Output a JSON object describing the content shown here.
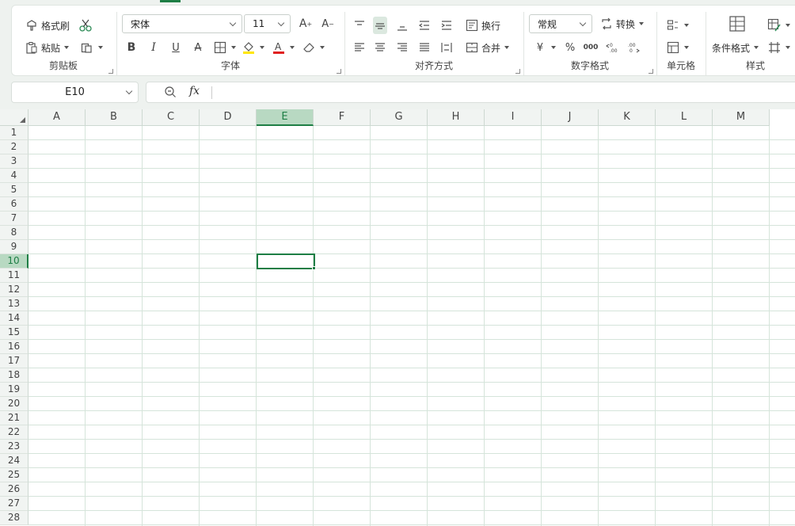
{
  "ribbon": {
    "clipboard": {
      "format_painter": "格式刷",
      "paste": "粘贴",
      "group_label": "剪贴板"
    },
    "font": {
      "font_name": "宋体",
      "font_size": "11",
      "group_label": "字体",
      "font_color": "#e02020",
      "highlight_color": "#ffe600"
    },
    "alignment": {
      "wrap": "换行",
      "merge": "合并",
      "group_label": "对齐方式"
    },
    "number": {
      "format": "常规",
      "convert": "转换",
      "currency": "¥",
      "percent": "%",
      "thousands": "000",
      "group_label": "数字格式"
    },
    "cells": {
      "group_label": "单元格"
    },
    "styles": {
      "conditional_format": "条件格式",
      "group_label": "样式"
    }
  },
  "formula_bar": {
    "name_box": "E10",
    "fx": "fx",
    "formula": ""
  },
  "grid": {
    "columns": [
      "A",
      "B",
      "C",
      "D",
      "E",
      "F",
      "G",
      "H",
      "I",
      "J",
      "K",
      "L",
      "M"
    ],
    "rows": [
      "1",
      "2",
      "3",
      "4",
      "5",
      "6",
      "7",
      "8",
      "9",
      "10",
      "11",
      "12",
      "13",
      "14",
      "15",
      "16",
      "17",
      "18",
      "19",
      "20",
      "21",
      "22",
      "23",
      "24",
      "25",
      "26",
      "27",
      "28"
    ],
    "active_column": "E",
    "active_row": "10",
    "accent_color": "#1e7e45"
  }
}
